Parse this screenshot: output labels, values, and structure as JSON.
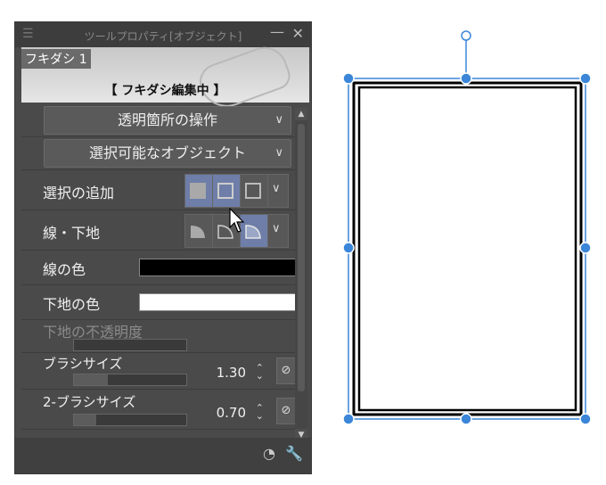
{
  "titlebar": {
    "title": "ツールプロパティ[オブジェクト]",
    "menu_icon": "menu-icon",
    "minimize_icon": "minimize-icon",
    "close_icon": "close-icon"
  },
  "preview": {
    "name": "フキダシ 1",
    "status": "【 フキダシ編集中 】"
  },
  "dropdowns": [
    {
      "label": "透明箇所の操作"
    },
    {
      "label": "選択可能なオブジェクト"
    }
  ],
  "rows": {
    "selection_add": {
      "label": "選択の追加",
      "buttons": [
        "new-selection",
        "add-selection",
        "subtract-selection"
      ],
      "active_index": 0
    },
    "line_fill": {
      "label": "線・下地",
      "buttons": [
        "fill-only",
        "line-only",
        "line-and-fill"
      ],
      "active_index": 2
    },
    "line_color": {
      "label": "線の色",
      "color": "#000000"
    },
    "fill_color": {
      "label": "下地の色",
      "color": "#ffffff"
    },
    "fill_opacity": {
      "label": "下地の不透明度"
    },
    "brush_size": {
      "label": "ブラシサイズ",
      "value": "1.30",
      "level": 0.3
    },
    "brush_size2": {
      "label": "2-ブラシサイズ",
      "value": "0.70",
      "level": 0.2
    }
  },
  "colors": {
    "panel_bg": "#4a4a4a",
    "accent": "#6e7ea8",
    "handle_blue": "#3b86d8"
  }
}
